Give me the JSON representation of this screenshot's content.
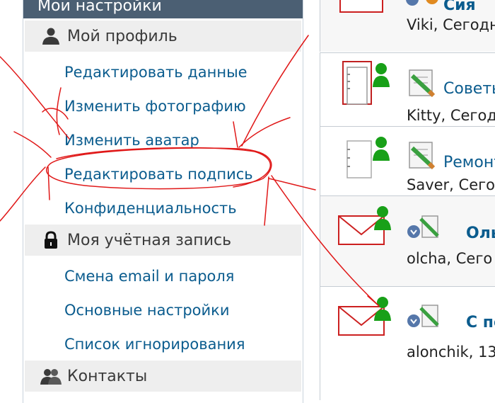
{
  "settings": {
    "header_title": "Мои настройки",
    "sections": [
      {
        "title": "Мой профиль",
        "icon": "user-icon",
        "items": [
          "Редактировать данные",
          "Изменить фотографию",
          "Изменить аватар",
          "Редактировать подпись",
          "Конфиденциальность"
        ]
      },
      {
        "title": "Моя учётная запись",
        "icon": "lock-icon",
        "items": [
          "Смена email и пароля",
          "Основные настройки",
          "Список игнорирования"
        ]
      },
      {
        "title": "Контакты",
        "icon": "contacts-icon",
        "items": []
      }
    ]
  },
  "topics": [
    {
      "title": "Сия",
      "meta": "Viki, Сегодн",
      "icon": "envelope-icon"
    },
    {
      "title": "Советы",
      "meta": "Kitty, Сегод",
      "icon": "document-icon"
    },
    {
      "title": "Ремонт",
      "meta": "Saver, Сего",
      "icon": "document-icon"
    },
    {
      "title": "Оль",
      "meta": "olcha, Сего",
      "icon": "envelope-icon"
    },
    {
      "title": "С по",
      "meta": "alonchik, 13",
      "icon": "envelope-icon"
    }
  ],
  "colors": {
    "link": "#0b5c8e",
    "header_bg": "#4b5f73",
    "section_bg": "#eeeeee",
    "annotation": "#e01818"
  }
}
